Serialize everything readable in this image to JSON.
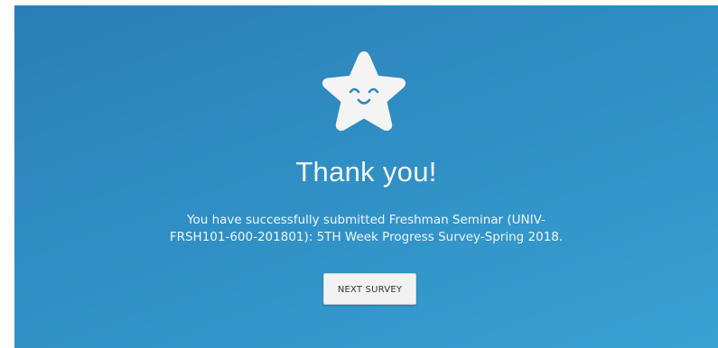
{
  "survey": {
    "heading": "Thank you!",
    "message_line1": "You have successfully submitted Freshman Seminar (UNIV-",
    "message_line2": "FRSH101-600-201801): 5TH Week Progress Survey-Spring 2018.",
    "next_button_label": "NEXT SURVEY",
    "icon": "smiling-star-icon"
  },
  "colors": {
    "background_top": "#2a7fb6",
    "background_bottom": "#3aa0d2",
    "star_fill": "#f4f4f4",
    "face_color": "#2d86bd",
    "button_bg": "#f2f2f2"
  }
}
